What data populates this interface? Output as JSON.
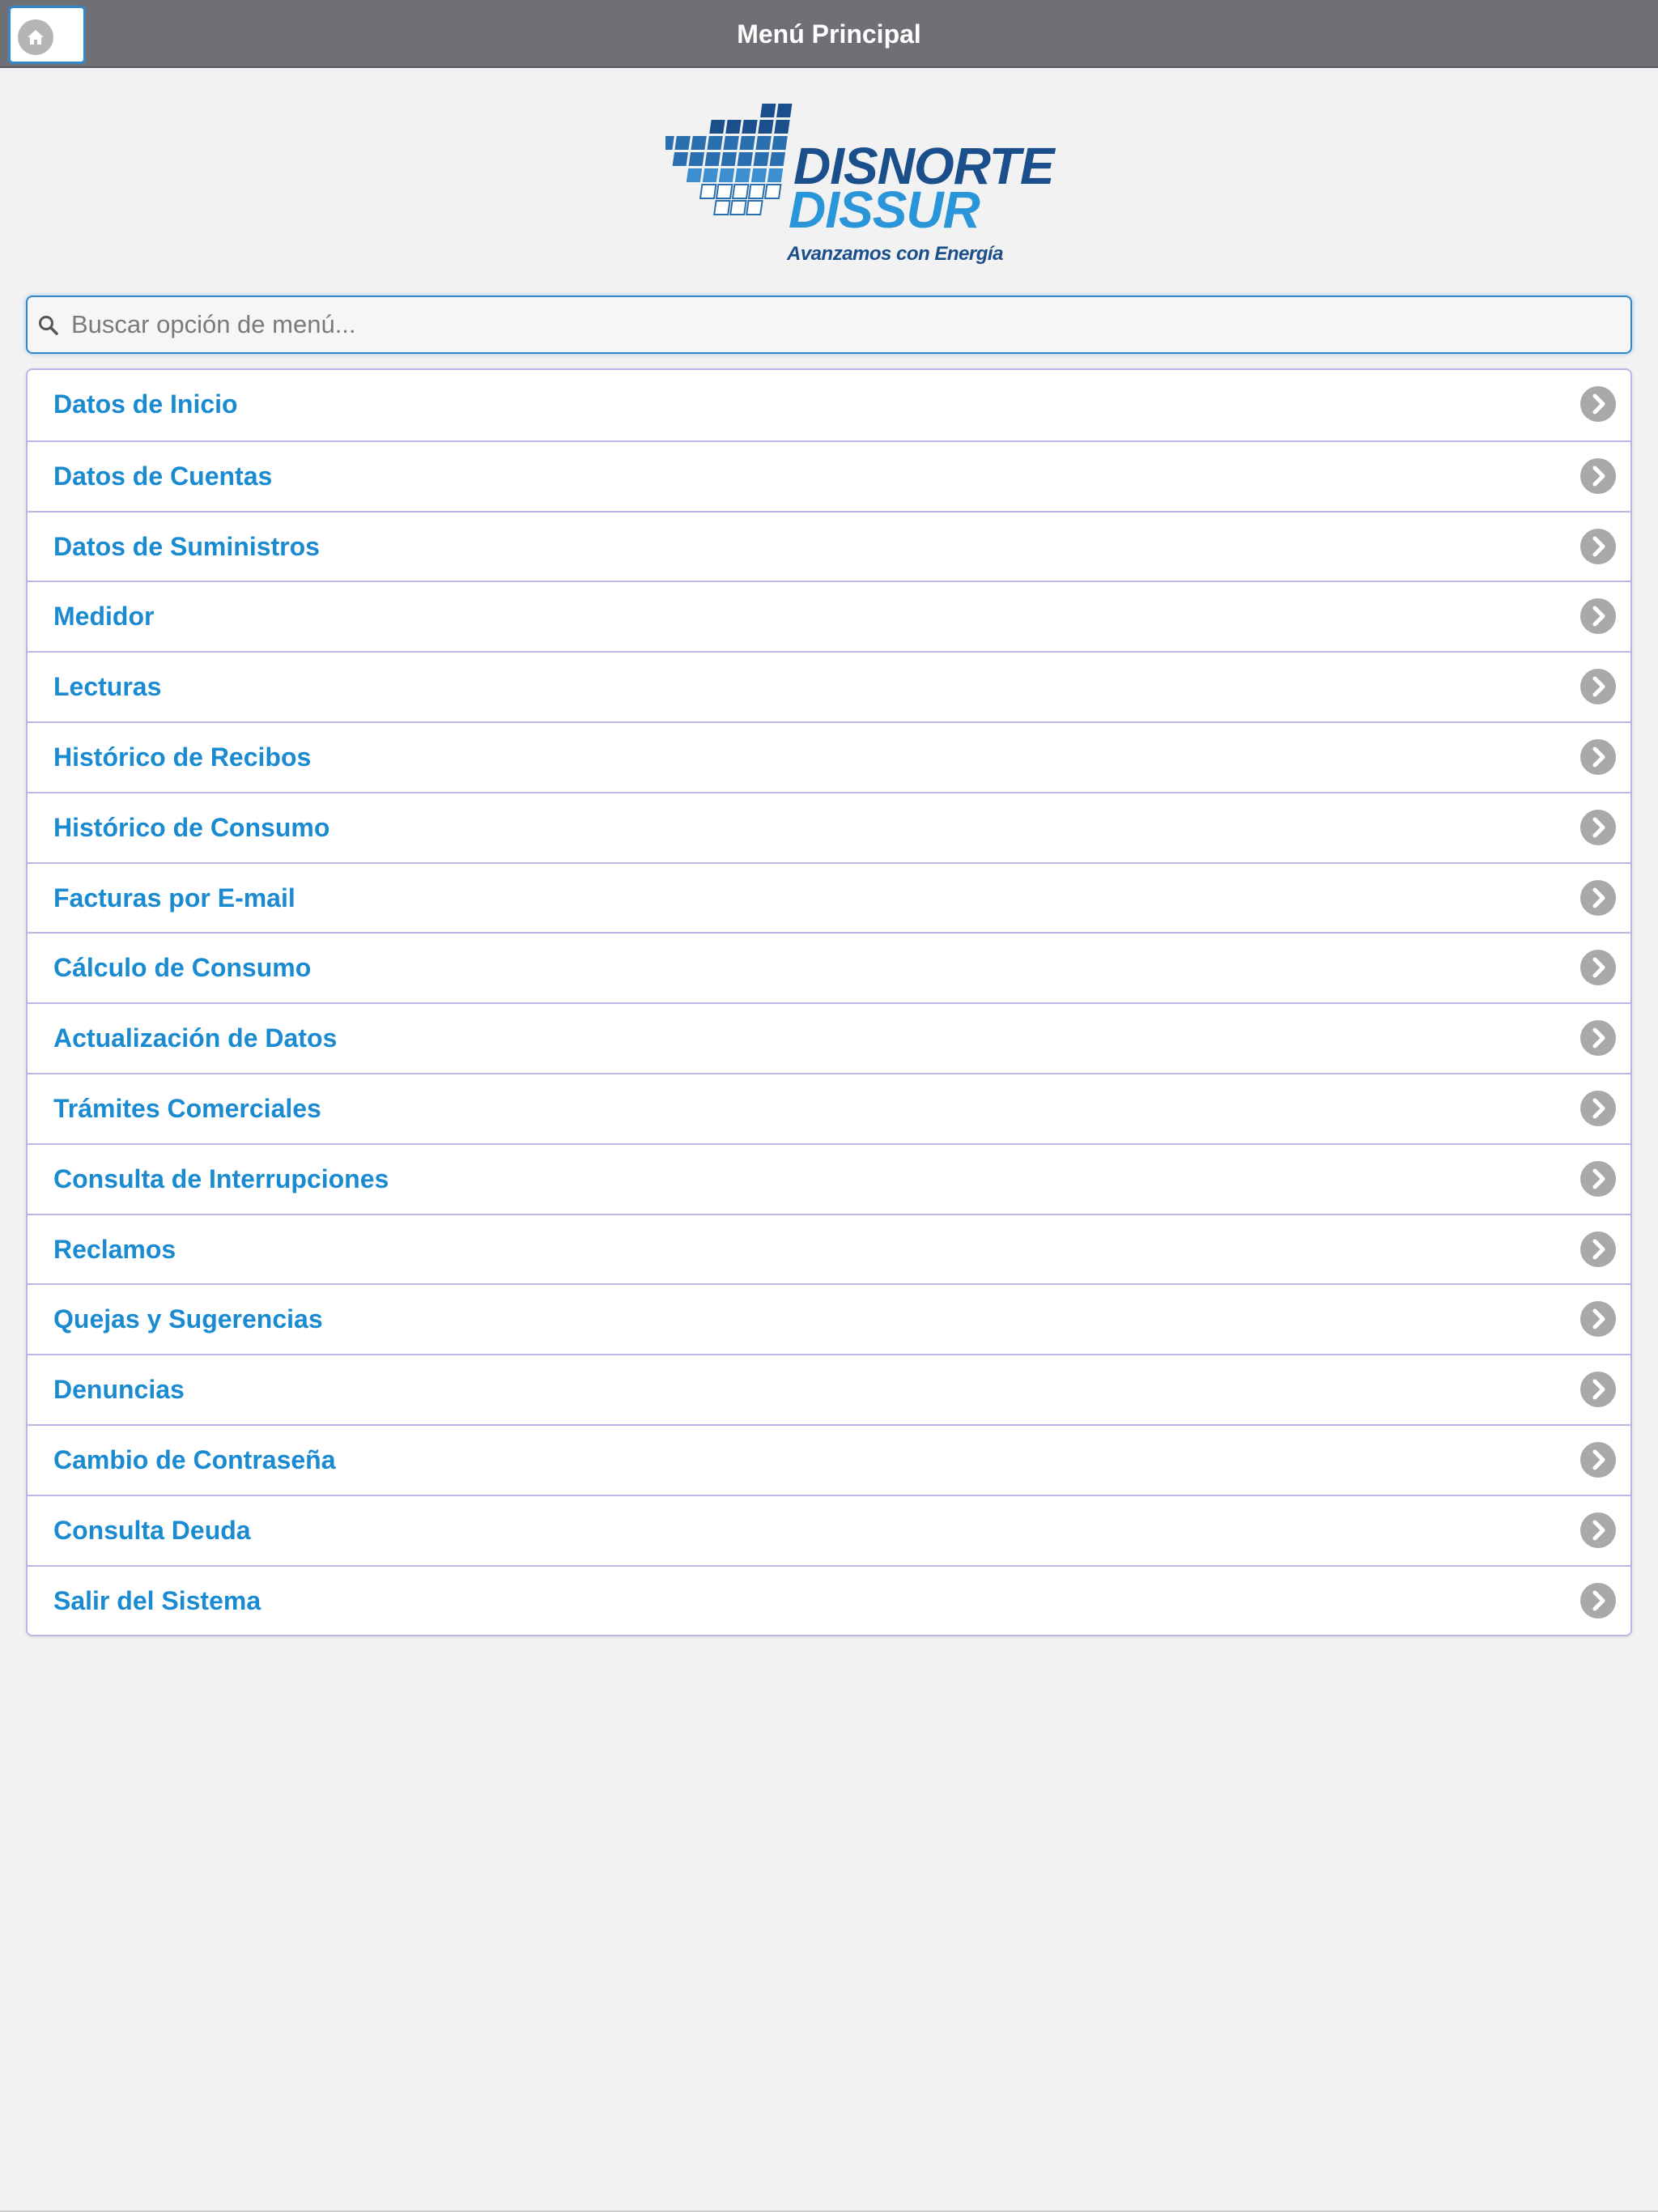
{
  "header": {
    "title": "Menú Principal",
    "home_icon": "home-icon"
  },
  "logo": {
    "line1": "DISNORTE",
    "line2": "DISSUR",
    "tagline": "Avanzamos con Energía"
  },
  "search": {
    "placeholder": "Buscar opción de menú...",
    "value": "",
    "icon": "search-icon"
  },
  "menu": {
    "items": [
      {
        "label": "Datos de Inicio",
        "icon": "chevron-right-icon"
      },
      {
        "label": "Datos de Cuentas",
        "icon": "chevron-right-icon"
      },
      {
        "label": "Datos de Suministros",
        "icon": "chevron-right-icon"
      },
      {
        "label": "Medidor",
        "icon": "chevron-right-icon"
      },
      {
        "label": "Lecturas",
        "icon": "chevron-right-icon"
      },
      {
        "label": "Histórico de Recibos",
        "icon": "chevron-right-icon"
      },
      {
        "label": "Histórico de Consumo",
        "icon": "chevron-right-icon"
      },
      {
        "label": "Facturas por E-mail",
        "icon": "chevron-right-icon"
      },
      {
        "label": "Cálculo de Consumo",
        "icon": "chevron-right-icon"
      },
      {
        "label": "Actualización de Datos",
        "icon": "chevron-right-icon"
      },
      {
        "label": "Trámites Comerciales",
        "icon": "chevron-right-icon"
      },
      {
        "label": "Consulta de Interrupciones",
        "icon": "chevron-right-icon"
      },
      {
        "label": "Reclamos",
        "icon": "chevron-right-icon"
      },
      {
        "label": "Quejas y Sugerencias",
        "icon": "chevron-right-icon"
      },
      {
        "label": "Denuncias",
        "icon": "chevron-right-icon"
      },
      {
        "label": "Cambio de Contraseña",
        "icon": "chevron-right-icon"
      },
      {
        "label": "Consulta Deuda",
        "icon": "chevron-right-icon"
      },
      {
        "label": "Salir del Sistema",
        "icon": "chevron-right-icon"
      }
    ]
  },
  "colors": {
    "header_bg": "#6f7075",
    "accent": "#3388cc",
    "link_text": "#1a8ad1",
    "logo_dark": "#1a4f8b",
    "logo_light": "#2a95d8",
    "chevron_bg": "#a9a9a9",
    "divider": "#b9b6e8"
  }
}
